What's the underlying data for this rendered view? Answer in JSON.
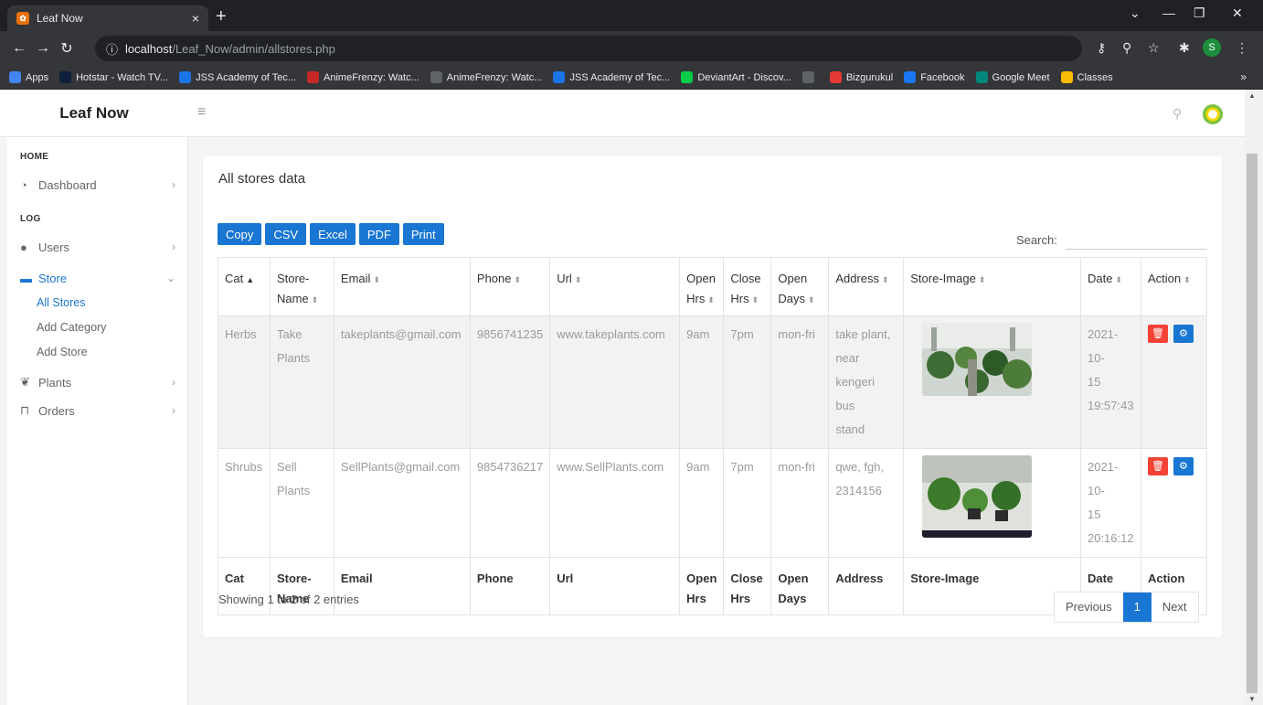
{
  "browser": {
    "tab_title": "Leaf Now",
    "tab_close": "×",
    "new_tab": "+",
    "url_host": "localhost",
    "url_path": "/Leaf_Now/admin/allstores.php",
    "profile_initial": "S",
    "bookmarks": [
      {
        "label": "Apps",
        "color": "#4285f4"
      },
      {
        "label": "Hotstar - Watch TV...",
        "color": "#0f1f3c"
      },
      {
        "label": "JSS Academy of Tec...",
        "color": "#1a73e8"
      },
      {
        "label": "AnimeFrenzy: Watc...",
        "color": "#c62828"
      },
      {
        "label": "AnimeFrenzy: Watc...",
        "color": "#5f6368"
      },
      {
        "label": "JSS Academy of Tec...",
        "color": "#1a73e8"
      },
      {
        "label": "DeviantArt - Discov...",
        "color": "#05cc47"
      },
      {
        "label": "",
        "color": "#5f6368"
      },
      {
        "label": "Bizgurukul",
        "color": "#e53935"
      },
      {
        "label": "Facebook",
        "color": "#1877f2"
      },
      {
        "label": "Google Meet",
        "color": "#00897b"
      },
      {
        "label": "Classes",
        "color": "#fbbc04"
      }
    ],
    "bookmarks_more": "»"
  },
  "header": {
    "brand": "Leaf Now",
    "menu_icon": "hamburger-icon",
    "search_icon": "search-icon"
  },
  "sidebar": {
    "home_heading": "HOME",
    "log_heading": "LOG",
    "items": {
      "dashboard": {
        "label": "Dashboard",
        "icon": "dashboard-icon"
      },
      "users": {
        "label": "Users",
        "icon": "user-icon"
      },
      "store": {
        "label": "Store",
        "icon": "store-icon"
      },
      "plants": {
        "label": "Plants",
        "icon": "leaf-icon"
      },
      "orders": {
        "label": "Orders",
        "icon": "cart-icon"
      }
    },
    "store_sub": {
      "all_stores": "All Stores",
      "add_category": "Add Category",
      "add_store": "Add Store"
    }
  },
  "main": {
    "title": "All stores data",
    "buttons": {
      "copy": "Copy",
      "csv": "CSV",
      "excel": "Excel",
      "pdf": "PDF",
      "print": "Print"
    },
    "search_label": "Search:",
    "columns": {
      "cat": "Cat",
      "store_name": "Store-Name",
      "store_name_1": "Store-",
      "store_name_2": "Name",
      "email": "Email",
      "phone": "Phone",
      "url": "Url",
      "open_hrs_1": "Open",
      "open_hrs_2": "Hrs",
      "close_hrs_1": "Close",
      "close_hrs_2": "Hrs",
      "open_days_1": "Open",
      "open_days_2": "Days",
      "address": "Address",
      "store_image": "Store-Image",
      "date": "Date",
      "action": "Action"
    },
    "rows": [
      {
        "cat": "Herbs",
        "store_name_1": "Take",
        "store_name_2": "Plants",
        "email": "takeplants@gmail.com",
        "phone": "9856741235",
        "url": "www.takeplants.com",
        "open_hrs": "9am",
        "close_hrs": "7pm",
        "open_days": "mon-fri",
        "address_1": "take plant,",
        "address_2": "near",
        "address_3": "kengeri bus",
        "address_4": "stand",
        "date_1": "2021-10-",
        "date_2": "15",
        "date_3": "19:57:43"
      },
      {
        "cat": "Shrubs",
        "store_name_1": "Sell",
        "store_name_2": "Plants",
        "email": "SellPlants@gmail.com",
        "phone": "9854736217",
        "url": "www.SellPlants.com",
        "open_hrs": "9am",
        "close_hrs": "7pm",
        "open_days": "mon-fri",
        "address_1": "qwe, fgh,",
        "address_2": "2314156",
        "date_1": "2021-10-",
        "date_2": "15",
        "date_3": "20:16:12"
      }
    ],
    "info": "Showing 1 to 2 of 2 entries",
    "pager": {
      "previous": "Previous",
      "current": "1",
      "next": "Next"
    }
  },
  "colors": {
    "primary": "#1976d2",
    "danger": "#f44336",
    "page_bg": "#f4f5f7"
  }
}
